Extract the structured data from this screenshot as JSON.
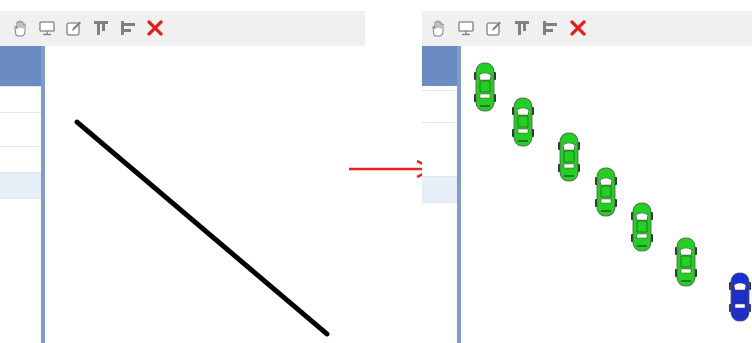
{
  "colors": {
    "toolbar_bg": "#f0f0f0",
    "header_strip": "#6b8bc3",
    "row_highlight": "#e6eef8",
    "divider": "#7f9ccb",
    "path_line": "#000000",
    "arrow": "#e8231b",
    "close_icon": "#e31b1b",
    "car_green": "#22d022",
    "car_blue": "#1a2fd6"
  },
  "toolbar": {
    "icons": [
      "pan-hand-icon",
      "monitor-icon",
      "edit-icon",
      "column-chart-icon",
      "bar-chart-icon",
      "close-icon"
    ]
  },
  "left_panel": {
    "path_line": {
      "from": "top-left",
      "to": "bottom-right"
    }
  },
  "transition": {
    "icon": "right-arrow-icon"
  },
  "right_panel": {
    "vehicles": [
      {
        "type": "car",
        "color": "green",
        "step": 1
      },
      {
        "type": "car",
        "color": "green",
        "step": 2
      },
      {
        "type": "car",
        "color": "green",
        "step": 3
      },
      {
        "type": "car",
        "color": "green",
        "step": 4
      },
      {
        "type": "car",
        "color": "green",
        "step": 5
      },
      {
        "type": "car",
        "color": "green",
        "step": 6
      },
      {
        "type": "car",
        "color": "blue",
        "step": 7
      }
    ]
  }
}
